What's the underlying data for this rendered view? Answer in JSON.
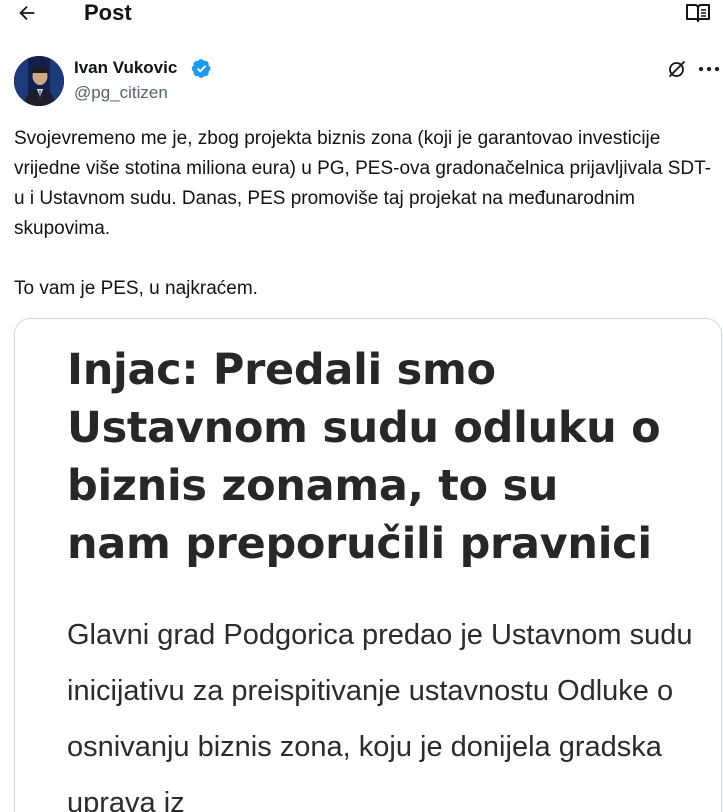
{
  "header": {
    "title": "Post",
    "back_icon": "arrow-left-icon",
    "reader_icon": "open-book-icon"
  },
  "author": {
    "name": "Ivan Vukovic",
    "handle": "@pg_citizen",
    "verified": true,
    "verified_color": "#1d9bf0"
  },
  "tweet": {
    "paragraph1": "Svojevremeno me je, zbog projekta biznis zona (koji je garantovao investicije vrijedne više stotina miliona eura) u PG, PES-ova gradonačelnica prijavljivala SDT-u i Ustavnom sudu. Danas, PES promoviše taj projekat na međunarodnim skupovima.",
    "paragraph2": "To vam je PES, u najkraćem."
  },
  "media": {
    "headline": "Injac: Predali smo Ustavnom sudu odluku o biznis zonama, to su nam preporučili pravnici",
    "lead": "Glavni grad Podgorica predao je Ustavnom sudu inicijativu za preispitivanje ustavnostu Odluke o osnivanju biznis zona, koju je donijela gradska uprava iz"
  },
  "colors": {
    "text": "#0f1419",
    "secondary": "#536471",
    "border": "#cfd9de",
    "accent": "#1d9bf0"
  }
}
